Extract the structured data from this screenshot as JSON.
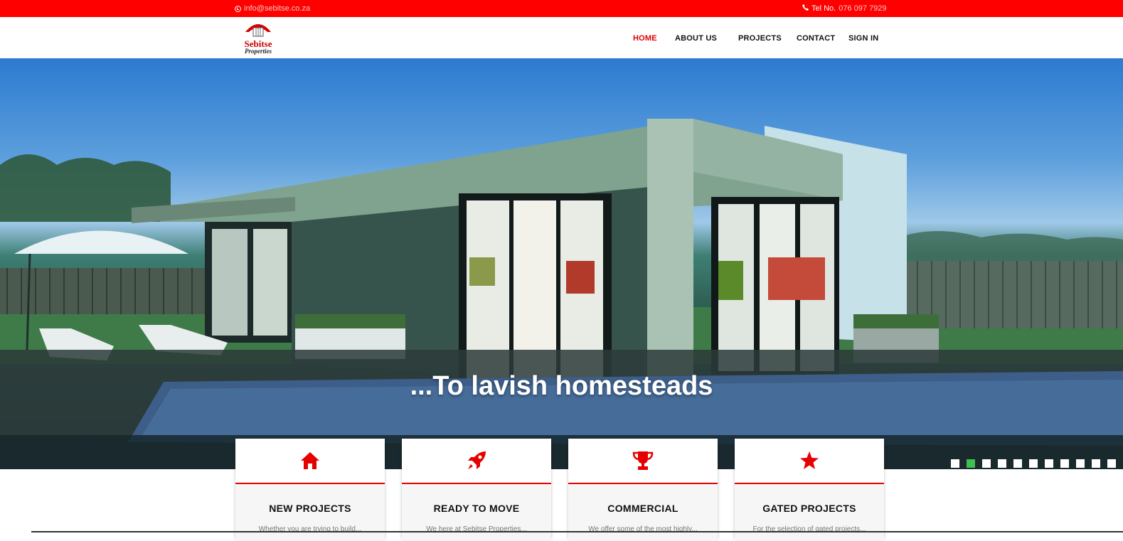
{
  "topbar": {
    "email": "info@sebitse.co.za",
    "tel_label": "Tel No.",
    "tel_value": "076 097 7929"
  },
  "logo": {
    "line1": "Sebitse",
    "line2": "Properties"
  },
  "nav": [
    {
      "label": "HOME",
      "active": true
    },
    {
      "label": "ABOUT US",
      "active": false
    },
    {
      "label": "PROJECTS",
      "active": false
    },
    {
      "label": "CONTACT",
      "active": false
    },
    {
      "label": "SIGN IN",
      "active": false
    }
  ],
  "hero": {
    "caption": "...To lavish homesteads",
    "slides": 12,
    "active_slide": 2
  },
  "cards": [
    {
      "icon": "home-icon",
      "title": "NEW PROJECTS",
      "desc": "Whether you are trying to build..."
    },
    {
      "icon": "rocket-icon",
      "title": "READY TO MOVE",
      "desc": "We here at Sebitse Properties..."
    },
    {
      "icon": "trophy-icon",
      "title": "COMMERCIAL",
      "desc": "We offer some of the most highly..."
    },
    {
      "icon": "star-icon",
      "title": "GATED PROJECTS",
      "desc": "For the selection of gated projects..."
    }
  ],
  "colors": {
    "brand": "#ff0000",
    "accent": "#e10000",
    "slide_active": "#3fbf4f"
  }
}
